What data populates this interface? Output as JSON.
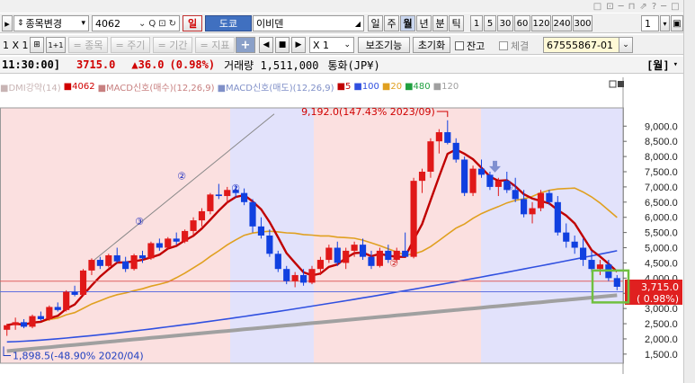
{
  "window_icons": [
    "□",
    "⊡",
    "─",
    "⊓",
    "⇗",
    "?",
    "─",
    "□",
    "×"
  ],
  "toolbar1": {
    "search_type": "종목변경",
    "code": "4062",
    "market_tag": "일",
    "exchange": "도쿄",
    "name": "이비덴",
    "periods": [
      "일",
      "주",
      "월",
      "년",
      "분",
      "틱"
    ],
    "selected_period": "월",
    "intervals": [
      "1",
      "5",
      "30",
      "60",
      "120",
      "240",
      "300"
    ],
    "count": "1"
  },
  "toolbar2": {
    "scale": "1 X 1",
    "grid_btn": "1+1",
    "disabled": [
      "= 종목",
      "= 주기",
      "= 기간",
      "= 지표"
    ],
    "multiplier": "X 1",
    "aux_btn": "보조기능",
    "reset_btn": "초기화",
    "balance_label": "잔고",
    "execution_label": "체결",
    "account": "67555867-01"
  },
  "info": {
    "time": "11:30:00]",
    "price": "3715.0",
    "change": "▲36.0",
    "pct": "(0.98%)",
    "volume": "거래량 1,511,000",
    "currency": "통화(JP¥)",
    "period_tag": "[월]"
  },
  "legend": {
    "items": [
      {
        "text": "DMI강약(14)",
        "color": "#c8b4b4"
      },
      {
        "text": "4062",
        "color": "#d00000"
      },
      {
        "text": "MACD신호(매수)(12,26,9)",
        "color": "#c88080"
      },
      {
        "text": "MACD신호(매도)(12,26,9)",
        "color": "#8090c8"
      },
      {
        "text": "5",
        "color": "#c00000"
      },
      {
        "text": "100",
        "color": "#3050e0"
      },
      {
        "text": "20",
        "color": "#e0a020"
      },
      {
        "text": "480",
        "color": "#20a040"
      },
      {
        "text": "120",
        "color": "#a0a0a0"
      }
    ]
  },
  "chart_data": {
    "type": "candlestick",
    "y_ticks": [
      "9,000.0",
      "8,500.0",
      "8,000.0",
      "7,500.0",
      "7,000.0",
      "6,500.0",
      "6,000.0",
      "5,500.0",
      "5,000.0",
      "4,500.0",
      "4,000.0",
      "3,500.0",
      "3,000.0",
      "2,500.0",
      "2,000.0",
      "1,500.0"
    ],
    "y_range": [
      1200,
      9600
    ],
    "current_price": "3,715.0",
    "current_pct": "( 0.98%)",
    "high_annotation": "9,192.0(147.43% 2023/09)",
    "low_annotation": "1,898.5(-48.90% 2020/04)",
    "markers": [
      "②",
      "③",
      "②",
      "②",
      "③"
    ],
    "candles": [
      [
        2300,
        2500,
        2100,
        2450
      ],
      [
        2450,
        2700,
        2300,
        2550
      ],
      [
        2550,
        2650,
        2350,
        2400
      ],
      [
        2400,
        2800,
        2350,
        2750
      ],
      [
        2750,
        2900,
        2600,
        2650
      ],
      [
        2650,
        3100,
        2600,
        3050
      ],
      [
        3050,
        3200,
        2900,
        2950
      ],
      [
        2950,
        3600,
        2900,
        3550
      ],
      [
        3550,
        3750,
        3400,
        3450
      ],
      [
        3450,
        4300,
        3400,
        4250
      ],
      [
        4250,
        4650,
        4100,
        4600
      ],
      [
        4600,
        4700,
        4300,
        4400
      ],
      [
        4400,
        4800,
        4350,
        4750
      ],
      [
        4750,
        5000,
        4500,
        4550
      ],
      [
        4550,
        4700,
        4200,
        4300
      ],
      [
        4300,
        4800,
        4250,
        4750
      ],
      [
        4750,
        4900,
        4500,
        4650
      ],
      [
        4650,
        5200,
        4600,
        5150
      ],
      [
        5150,
        5300,
        4900,
        5000
      ],
      [
        5000,
        5350,
        4950,
        5300
      ],
      [
        5300,
        5500,
        5100,
        5200
      ],
      [
        5200,
        5600,
        5150,
        5550
      ],
      [
        5550,
        6000,
        5400,
        5900
      ],
      [
        5900,
        6300,
        5700,
        6200
      ],
      [
        6200,
        6800,
        6100,
        6750
      ],
      [
        6750,
        7100,
        6600,
        6700
      ],
      [
        6700,
        7000,
        6450,
        6900
      ],
      [
        6900,
        7050,
        6650,
        6800
      ],
      [
        6800,
        6950,
        6400,
        6500
      ],
      [
        6500,
        6600,
        5500,
        5700
      ],
      [
        5700,
        6000,
        5300,
        5400
      ],
      [
        5400,
        5600,
        4700,
        4800
      ],
      [
        4800,
        4900,
        4200,
        4300
      ],
      [
        4300,
        4400,
        3800,
        3900
      ],
      [
        3900,
        4200,
        3700,
        4100
      ],
      [
        4100,
        4300,
        3750,
        3850
      ],
      [
        3850,
        4400,
        3800,
        4300
      ],
      [
        4300,
        4700,
        4100,
        4600
      ],
      [
        4600,
        5100,
        4500,
        5000
      ],
      [
        5000,
        5200,
        4400,
        4500
      ],
      [
        4500,
        5000,
        4300,
        4900
      ],
      [
        4900,
        5200,
        4700,
        5100
      ],
      [
        5100,
        5300,
        4600,
        4700
      ],
      [
        4700,
        4900,
        4300,
        4400
      ],
      [
        4400,
        5000,
        4350,
        4900
      ],
      [
        4900,
        5100,
        4500,
        4600
      ],
      [
        4600,
        5000,
        4500,
        4900
      ],
      [
        4900,
        5500,
        4800,
        4700
      ],
      [
        4700,
        7300,
        4650,
        7200
      ],
      [
        7200,
        7600,
        6800,
        7500
      ],
      [
        7500,
        8600,
        7300,
        8500
      ],
      [
        8500,
        8900,
        8100,
        8800
      ],
      [
        8800,
        9192,
        8400,
        8450
      ],
      [
        8450,
        8600,
        7800,
        7900
      ],
      [
        7900,
        8000,
        6700,
        6800
      ],
      [
        6800,
        7700,
        6700,
        7600
      ],
      [
        7600,
        7900,
        7300,
        7400
      ],
      [
        7400,
        7500,
        6900,
        7000
      ],
      [
        7000,
        7300,
        6700,
        7200
      ],
      [
        7200,
        7500,
        6800,
        6900
      ],
      [
        6900,
        7300,
        6500,
        6600
      ],
      [
        6600,
        6900,
        6000,
        6100
      ],
      [
        6100,
        6500,
        5800,
        6300
      ],
      [
        6300,
        6900,
        6200,
        6800
      ],
      [
        6800,
        6900,
        6400,
        6500
      ],
      [
        6500,
        6700,
        5400,
        5500
      ],
      [
        5500,
        5800,
        5000,
        5200
      ],
      [
        5200,
        5400,
        4800,
        5000
      ],
      [
        5000,
        5300,
        4400,
        4600
      ],
      [
        4600,
        4900,
        4200,
        4300
      ],
      [
        4300,
        4600,
        4100,
        4450
      ],
      [
        4450,
        4600,
        3900,
        4000
      ],
      [
        4000,
        4100,
        3600,
        3715
      ]
    ]
  }
}
